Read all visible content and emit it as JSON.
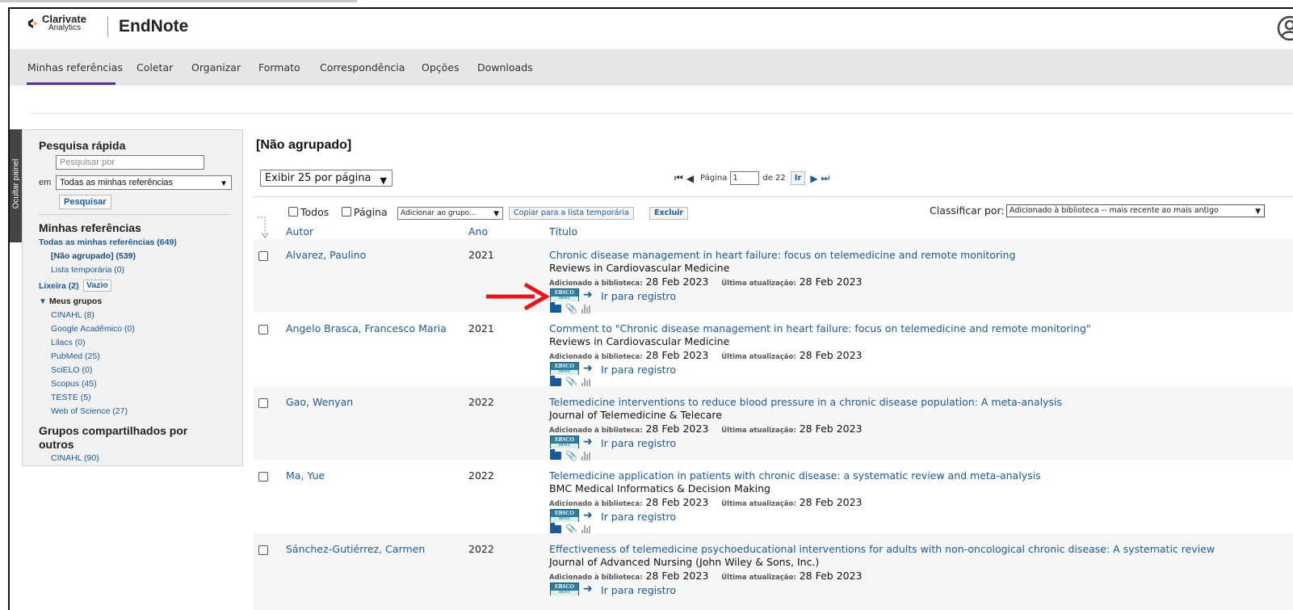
{
  "header": {
    "brand_line1": "Clarivate",
    "brand_line2": "Analytics",
    "app_title": "EndNote"
  },
  "nav": {
    "items": [
      "Minhas referências",
      "Coletar",
      "Organizar",
      "Formato",
      "Correspondência",
      "Opções",
      "Downloads"
    ],
    "active": "Minhas referências"
  },
  "hide_panel": "Ocultar painel",
  "sidebar": {
    "quick_search_title": "Pesquisa rápida",
    "search_placeholder": "Pesquisar por",
    "in_label": "em",
    "scope_value": "Todas as minhas referências",
    "search_button": "Pesquisar",
    "my_refs_title": "Minhas referências",
    "all_refs": "Todas as minhas referências (649)",
    "unfiled": "[Não agrupado] (539)",
    "temp_list": "Lista temporária (0)",
    "trash": "Lixeira (2)",
    "empty_button": "Vazio",
    "my_groups": "Meus grupos",
    "groups": [
      "CINAHL  (8)",
      "Google Acadêmico  (0)",
      "Lilacs  (0)",
      "PubMed  (25)",
      "SciELO  (0)",
      "Scopus  (45)",
      "TESTE  (5)",
      "Web of Science  (27)"
    ],
    "shared_title": "Grupos compartilhados por outros",
    "shared_groups": [
      "CINAHL  (90)"
    ]
  },
  "main": {
    "title": "[Não agrupado]",
    "per_page": "Exibir 25 por página",
    "pager": {
      "page_label": "Página",
      "page_value": "1",
      "of_label": "de 22",
      "go_button": "Ir"
    },
    "toolbar": {
      "all_label": "Todos",
      "page_label": "Página",
      "add_to_group": "Adicionar ao grupo...",
      "copy_button": "Copiar para a lista temporária",
      "delete_button": "Excluir",
      "sort_label": "Classificar por:",
      "sort_value": "Adicionado à biblioteca -- mais recente ao mais antigo"
    },
    "columns": {
      "author": "Autor",
      "year": "Ano",
      "title": "Título"
    },
    "added_label": "Adicionado à biblioteca:",
    "updated_label": "Última atualização:",
    "ebsco_label": "EBSCO",
    "ebsco_host": "HOST",
    "goto_label": "Ir para registro",
    "rows": [
      {
        "author": "Alvarez, Paulino",
        "year": "2021",
        "title": "Chronic disease management in heart failure: focus on telemedicine and remote monitoring",
        "journal": "Reviews in Cardiovascular Medicine",
        "added": "28 Feb 2023",
        "updated": "28 Feb 2023"
      },
      {
        "author": "Angelo Brasca, Francesco Maria",
        "year": "2021",
        "title": "Comment to \"Chronic disease management in heart failure: focus on telemedicine and remote monitoring\"",
        "journal": "Reviews in Cardiovascular Medicine",
        "added": "28 Feb 2023",
        "updated": "28 Feb 2023"
      },
      {
        "author": "Gao, Wenyan",
        "year": "2022",
        "title": "Telemedicine interventions to reduce blood pressure in a chronic disease population: A meta-analysis",
        "journal": "Journal of Telemedicine & Telecare",
        "added": "28 Feb 2023",
        "updated": "28 Feb 2023"
      },
      {
        "author": "Ma, Yue",
        "year": "2022",
        "title": "Telemedicine application in patients with chronic disease: a systematic review and meta-analysis",
        "journal": "BMC Medical Informatics & Decision Making",
        "added": "28 Feb 2023",
        "updated": "28 Feb 2023"
      },
      {
        "author": "Sánchez-Gutiérrez, Carmen",
        "year": "2022",
        "title": "Effectiveness of telemedicine psychoeducational interventions for adults with non-oncological chronic disease: A systematic review",
        "journal": "Journal of Advanced Nursing (John Wiley & Sons, Inc.)",
        "added": "28 Feb 2023",
        "updated": "28 Feb 2023"
      }
    ]
  },
  "colors": {
    "accent_purple": "#5c2d91",
    "link_blue": "#1a5a9a",
    "annotation_red": "#e8141b"
  }
}
